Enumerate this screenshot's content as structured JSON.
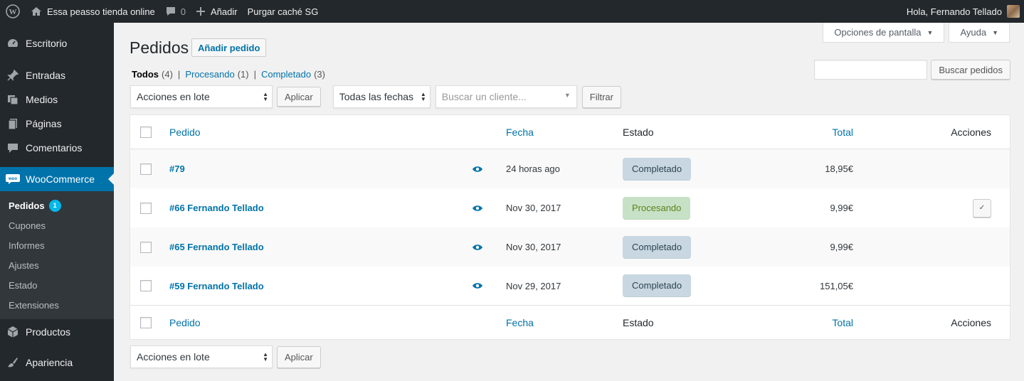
{
  "adminbar": {
    "site_name": "Essa peasso tienda online",
    "comments_count": "0",
    "new_label": "Añadir",
    "purge_label": "Purgar caché SG",
    "greeting": "Hola, Fernando Tellado"
  },
  "sidebar": {
    "items": [
      {
        "label": "Escritorio",
        "icon": "dashboard-icon"
      },
      {
        "label": "Entradas",
        "icon": "pin-icon"
      },
      {
        "label": "Medios",
        "icon": "media-icon"
      },
      {
        "label": "Páginas",
        "icon": "page-icon"
      },
      {
        "label": "Comentarios",
        "icon": "comment-icon"
      },
      {
        "label": "WooCommerce",
        "icon": "woo-icon"
      },
      {
        "label": "Productos",
        "icon": "box-icon"
      },
      {
        "label": "Apariencia",
        "icon": "brush-icon"
      }
    ],
    "woo_submenu": [
      {
        "label": "Pedidos",
        "badge": "1"
      },
      {
        "label": "Cupones"
      },
      {
        "label": "Informes"
      },
      {
        "label": "Ajustes"
      },
      {
        "label": "Estado"
      },
      {
        "label": "Extensiones"
      }
    ]
  },
  "screen_meta": {
    "options_label": "Opciones de pantalla",
    "help_label": "Ayuda"
  },
  "page": {
    "title": "Pedidos",
    "add_new_label": "Añadir pedido"
  },
  "filters": {
    "views": [
      {
        "label": "Todos",
        "count": "(4)"
      },
      {
        "label": "Procesando",
        "count": "(1)"
      },
      {
        "label": "Completado",
        "count": "(3)"
      }
    ],
    "search_button": "Buscar pedidos",
    "bulk_actions": "Acciones en lote",
    "apply_label": "Aplicar",
    "dates": "Todas las fechas",
    "customer_placeholder": "Buscar un cliente...",
    "filter_label": "Filtrar"
  },
  "table": {
    "columns": {
      "order": "Pedido",
      "date": "Fecha",
      "status": "Estado",
      "total": "Total",
      "actions": "Acciones"
    },
    "rows": [
      {
        "order": "#79",
        "date": "24 horas ago",
        "status": "Completado",
        "total": "18,95€"
      },
      {
        "order": "#66 Fernando Tellado",
        "date": "Nov 30, 2017",
        "status": "Procesando",
        "total": "9,99€",
        "action": "✓"
      },
      {
        "order": "#65 Fernando Tellado",
        "date": "Nov 30, 2017",
        "status": "Completado",
        "total": "9,99€"
      },
      {
        "order": "#59 Fernando Tellado",
        "date": "Nov 29, 2017",
        "status": "Completado",
        "total": "151,05€"
      }
    ]
  },
  "colors": {
    "admin_dark": "#23282d",
    "accent": "#0073aa",
    "completed_bg": "#c8d7e1",
    "processing_bg": "#c6e1c6"
  }
}
